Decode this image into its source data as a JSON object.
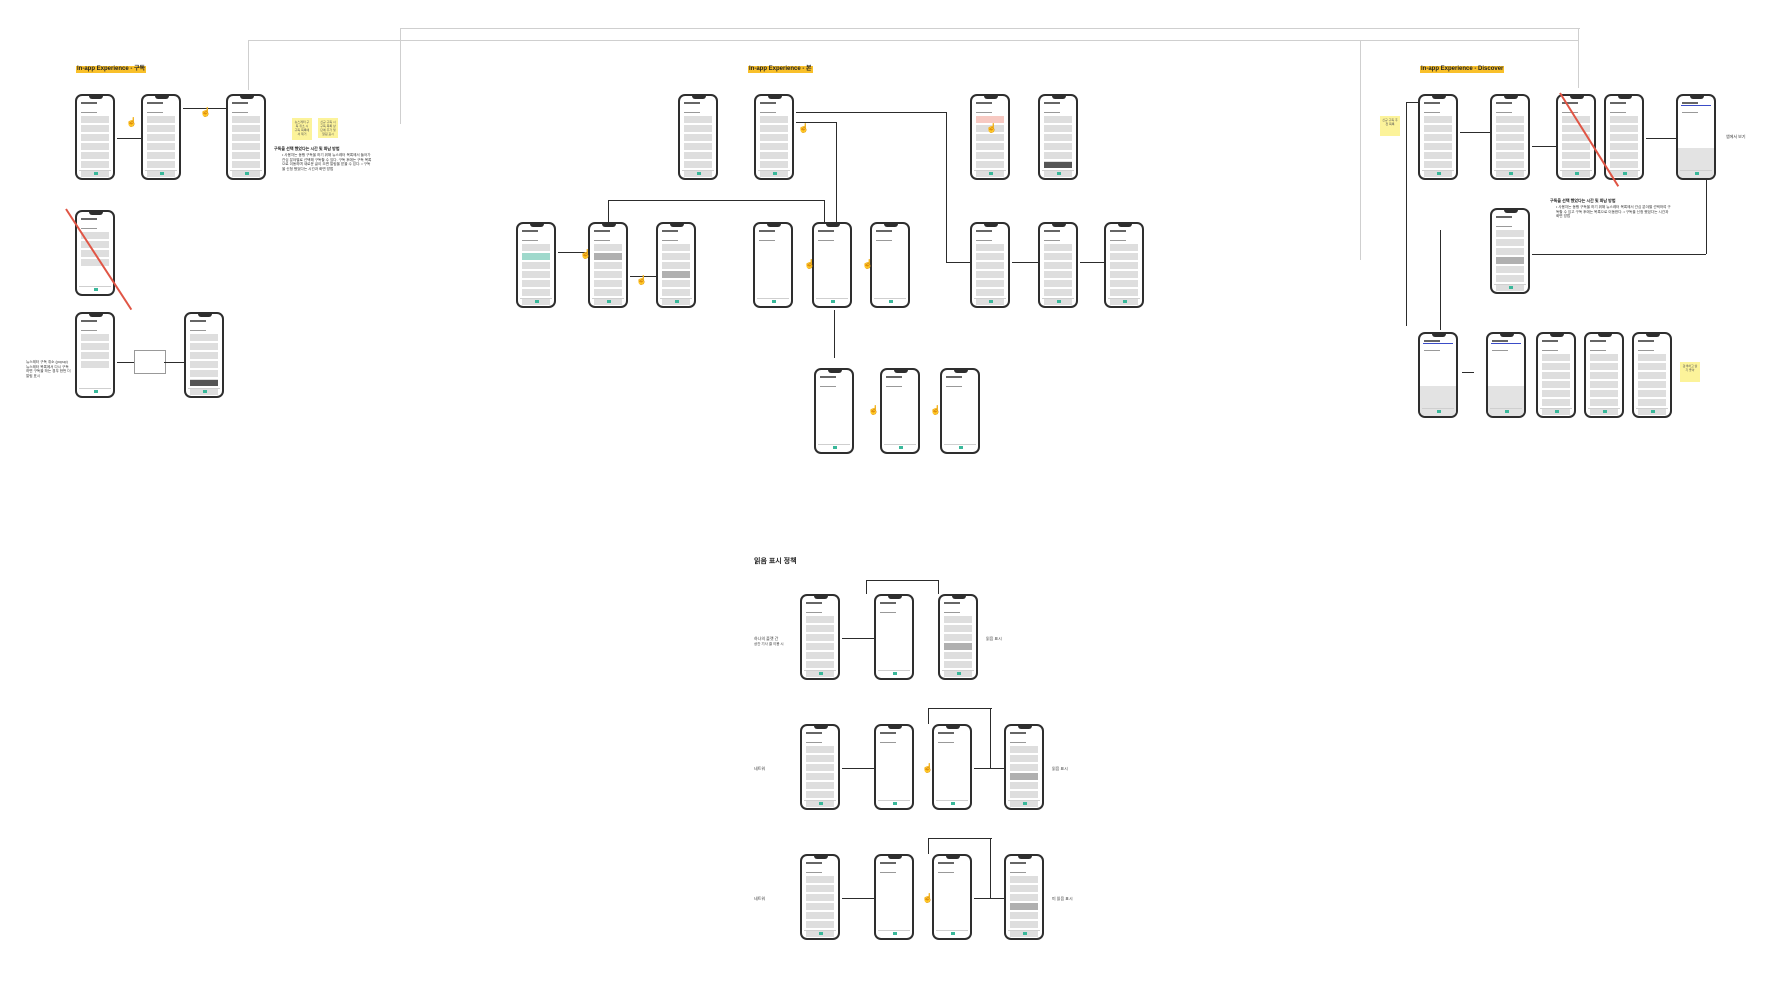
{
  "sections": [
    {
      "id": "left",
      "title": "In-app Experience - 구독"
    },
    {
      "id": "middle",
      "title": "In-app Experience - 본"
    },
    {
      "id": "right",
      "title": "In-app Experience - Discover"
    }
  ],
  "bottom_section": {
    "heading": "읽음 표시 정책"
  },
  "labels": {
    "right_top_label": "앱에서 보기",
    "bottom_row1_left": "하나의 플랫 간",
    "bottom_row1_left_sub": "상간 기사 클 이용 시",
    "bottom_row1_right": "읽음 표시",
    "bottom_row2_left": "네트워",
    "bottom_row2_right": "읽음 표시",
    "bottom_row3_left": "네트워",
    "bottom_row3_right": "미 읽음 표시",
    "left_lower_note": "뉴스레터 구독 취소 (popup) 뉴스레터 목록에서 다시 구독 하면 구독을 하는 경우 한번 더 알림 표시",
    "left_notes_title": "구독을 선택 했었다는 시간 및 화남 방법",
    "left_notes_body": "• 사용자는 동행 구독을 하기 위해 뉴스레터 목록에서 들어가 관심 분야별로 선택해 구독할 수 있다. 구독 후에는 구독 목록으로 이동하며 새로운 글이 오면 알림을 받을 수 있다. • 구독을 신청 했었다는 시간과 화면 방법",
    "right_notes_title": "구독을 선택 했었다는 시간 및 화남 방법",
    "right_notes_body": "• 사용자는 동행 구독을 하기 위해 뉴스레터 목록에서 관심 분야별 선택하여 구독할 수 있고 구독 후에는 목록으로 이동한다. • 구독을 신청 했었다는 시간과 화면 방법"
  },
  "stickies": {
    "sticky_left_1": "뉴스레터 구독 취소 시 구독 목록에서 제거",
    "sticky_left_2": "신규 구독 시 구독 목록 상단에 추가 및 알림 표시",
    "sticky_right_1": "신규 구독 추천 목록",
    "sticky_right_2": "검색하고 살기 좋아"
  },
  "colors": {
    "highlight": "#f9c02a",
    "sticky": "#fcf39a",
    "teal": "#39b89a",
    "strike": "#e05545"
  }
}
